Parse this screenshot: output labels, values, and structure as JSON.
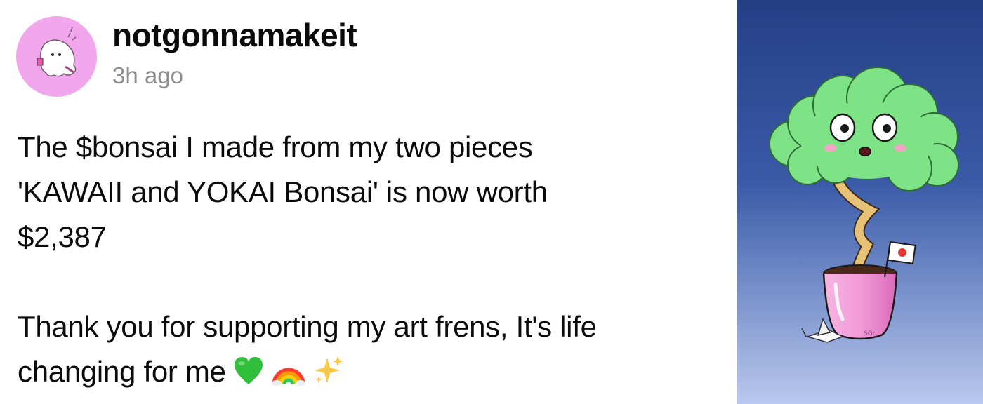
{
  "post": {
    "username": "notgonnamakeit",
    "timestamp": "3h ago",
    "text_lines": [
      "The $bonsai I made from my two pieces",
      "'KAWAII and YOKAI Bonsai' is now worth",
      "$2,387"
    ],
    "text_line_4": "Thank you for supporting my art frens, It's life",
    "text_line_5": "changing for me",
    "emojis": [
      "green-heart-icon",
      "rainbow-icon",
      "sparkles-icon"
    ]
  },
  "artwork": {
    "subject": "bonsai-character-icon",
    "signature": "SGr",
    "colors": {
      "sky_top": "#253f86",
      "sky_bottom": "#b9c9ee",
      "foliage": "#7de386",
      "pot": "#f39ad8",
      "trunk": "#e7c276"
    }
  },
  "avatar": {
    "background": "#f2a7ec",
    "subject": "ghost-avatar-icon"
  }
}
